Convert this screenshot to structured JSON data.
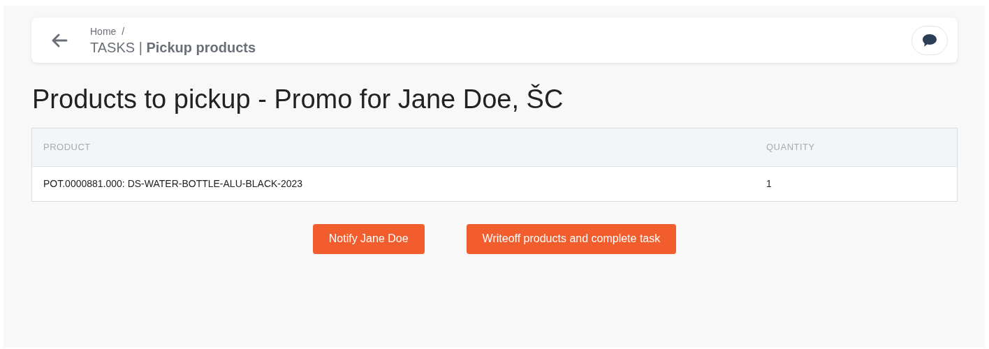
{
  "header": {
    "breadcrumb": [
      {
        "label": "Home",
        "separator": "/"
      }
    ],
    "title": "TASKS | **Pickup products**"
  },
  "heading": "Products to pickup - Promo for Jane Doe, ŠC",
  "table": {
    "columns": [
      "PRODUCT",
      "QUANTITY"
    ],
    "rows": [
      [
        "POT.0000881.000: DS-WATER-BOTTLE-ALU-BLACK-2023",
        "1"
      ]
    ]
  },
  "buttons": [
    "Notify Jane Doe",
    "Writeoff products and complete task"
  ]
}
